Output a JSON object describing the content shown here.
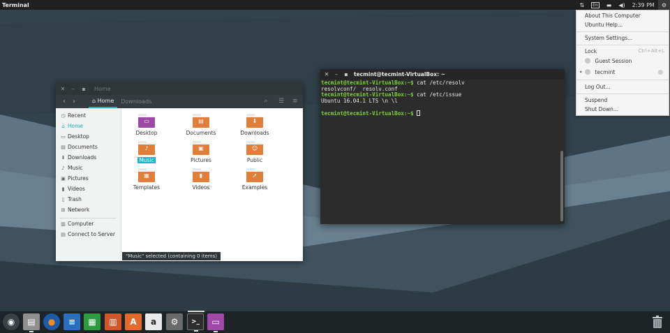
{
  "top_panel": {
    "app_title": "Terminal",
    "indicators": {
      "network": "⇅",
      "keyboard": "En",
      "battery": "▬",
      "volume": "◀)",
      "clock": "2:39 PM",
      "power": "⚙"
    }
  },
  "system_menu": {
    "about": "About This Computer",
    "help": "Ubuntu Help...",
    "settings": "System Settings...",
    "lock": "Lock",
    "lock_shortcut": "Ctrl+Alt+L",
    "guest": "Guest Session",
    "user": "tecmint",
    "logout": "Log Out...",
    "suspend": "Suspend",
    "shutdown": "Shut Down..."
  },
  "file_manager": {
    "title": "Home",
    "breadcrumb": [
      "Home",
      "Downloads"
    ],
    "sidebar": {
      "places": [
        "Recent",
        "Home",
        "Desktop",
        "Documents",
        "Downloads",
        "Music",
        "Pictures",
        "Videos",
        "Trash",
        "Network"
      ],
      "devices": [
        "Computer",
        "Connect to Server"
      ],
      "active": "Home"
    },
    "folders": [
      {
        "name": "Desktop",
        "color": "#9c4aa3",
        "glyph": "▭"
      },
      {
        "name": "Documents",
        "color": "#e07f3c",
        "glyph": "▤"
      },
      {
        "name": "Downloads",
        "color": "#e07f3c",
        "glyph": "⬇"
      },
      {
        "name": "Music",
        "color": "#e07f3c",
        "glyph": "♪",
        "selected": true
      },
      {
        "name": "Pictures",
        "color": "#e07f3c",
        "glyph": "▣"
      },
      {
        "name": "Public",
        "color": "#e07f3c",
        "glyph": "☺"
      },
      {
        "name": "Templates",
        "color": "#e07f3c",
        "glyph": "▦"
      },
      {
        "name": "Videos",
        "color": "#e07f3c",
        "glyph": "▮"
      },
      {
        "name": "Examples",
        "color": "#e07f3c",
        "glyph": "➚"
      }
    ],
    "status": "\"Music\" selected  (containing 0 items)",
    "accent": "#19b6c8"
  },
  "terminal": {
    "title": "tecmint@tecmint-VirtualBox: ~",
    "lines": [
      {
        "prompt": "tecmint@tecmint-VirtualBox:~$",
        "text": " cat /etc/resolv"
      },
      {
        "prompt": "",
        "text": "resolvconf/  resolv.conf"
      },
      {
        "prompt": "tecmint@tecmint-VirtualBox:~$",
        "text": " cat /etc/issue"
      },
      {
        "prompt": "",
        "text": "Ubuntu 16.04.1 LTS \\n \\l"
      },
      {
        "prompt": "",
        "text": ""
      },
      {
        "prompt": "tecmint@tecmint-VirtualBox:~$",
        "text": " ",
        "cursor": true
      }
    ],
    "prompt_color": "#7fd33b"
  },
  "dock": {
    "items": [
      {
        "name": "ubuntu-launcher",
        "glyph": "◉",
        "bg": "#3b4246"
      },
      {
        "name": "file-manager",
        "glyph": "▤",
        "bg": "#8f8f8f",
        "running": true
      },
      {
        "name": "firefox",
        "glyph": "●",
        "bg": "#1e5aa8"
      },
      {
        "name": "libreoffice-writer",
        "glyph": "≡",
        "bg": "#2a6ebf"
      },
      {
        "name": "libreoffice-calc",
        "glyph": "▦",
        "bg": "#2c9a3f"
      },
      {
        "name": "libreoffice-impress",
        "glyph": "▥",
        "bg": "#d1572b"
      },
      {
        "name": "software-center",
        "glyph": "A",
        "bg": "#e26a2c"
      },
      {
        "name": "amazon",
        "glyph": "a",
        "bg": "#e9e9e9"
      },
      {
        "name": "settings",
        "glyph": "⚙",
        "bg": "#6a6a6a"
      },
      {
        "name": "terminal",
        "glyph": ">_",
        "bg": "#2d2d2d",
        "running": true,
        "focused": true
      },
      {
        "name": "files",
        "glyph": "▭",
        "bg": "#a147a8",
        "running": true
      },
      {
        "name": "trash",
        "glyph": "🗑",
        "bg": "#1e2326"
      }
    ]
  }
}
